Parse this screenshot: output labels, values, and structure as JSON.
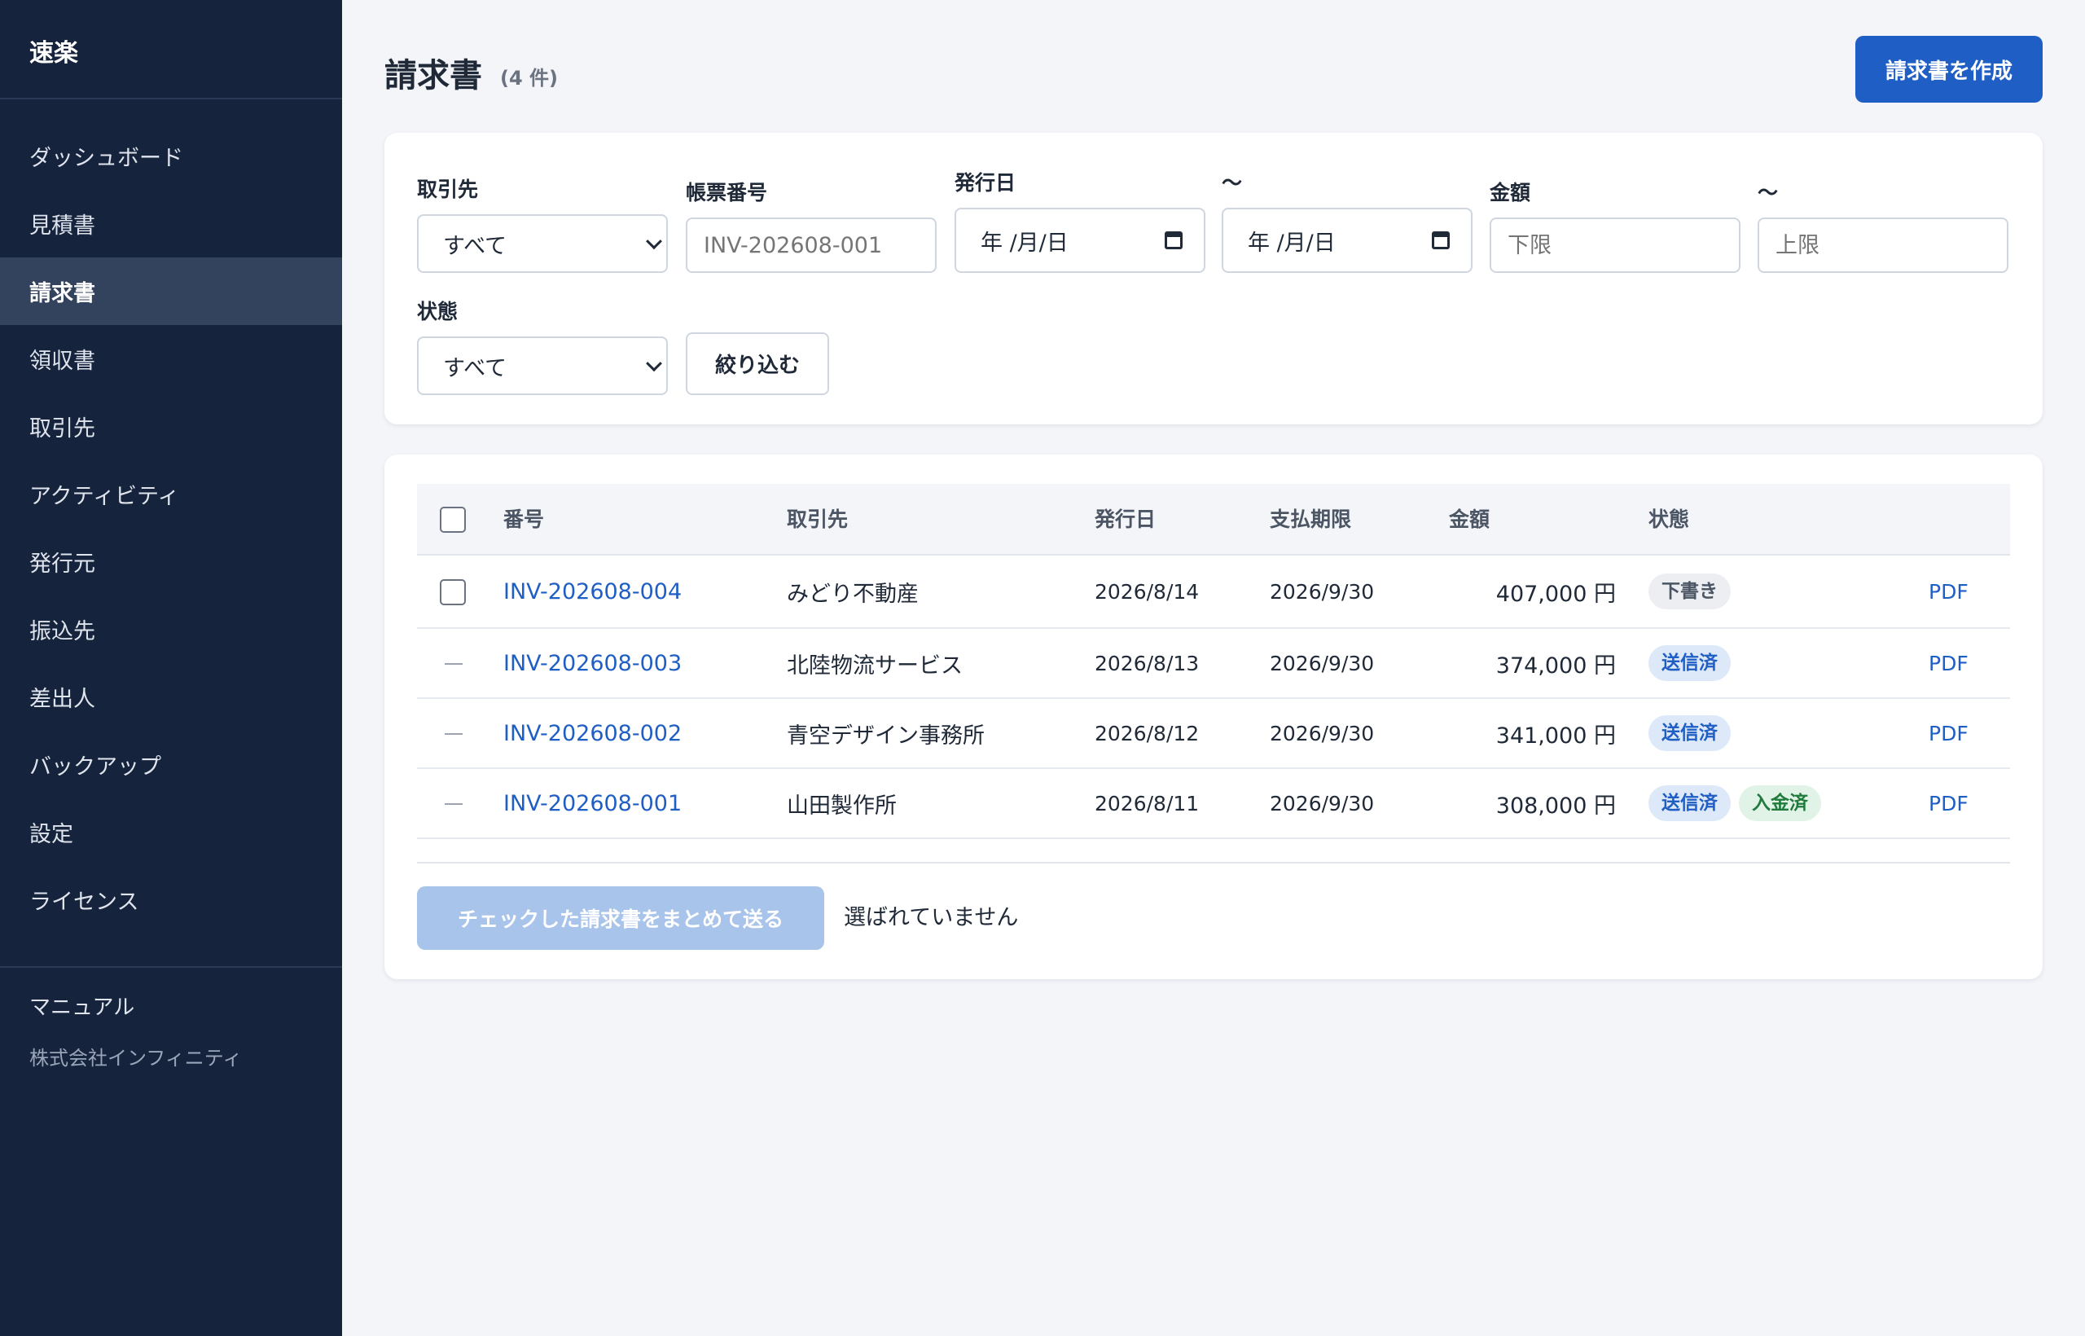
{
  "app": {
    "brand": "速楽"
  },
  "sidebar": {
    "items": [
      {
        "label": "ダッシュボード"
      },
      {
        "label": "見積書"
      },
      {
        "label": "請求書"
      },
      {
        "label": "領収書"
      },
      {
        "label": "取引先"
      },
      {
        "label": "アクティビティ"
      },
      {
        "label": "発行元"
      },
      {
        "label": "振込先"
      },
      {
        "label": "差出人"
      },
      {
        "label": "バックアップ"
      },
      {
        "label": "設定"
      },
      {
        "label": "ライセンス"
      }
    ],
    "active_item": "請求書",
    "manual_label": "マニュアル",
    "company": "株式会社インフィニティ"
  },
  "header": {
    "title": "請求書",
    "count": "(4 件)",
    "create_button": "請求書を作成"
  },
  "filters": {
    "client": {
      "label": "取引先",
      "value": "すべて"
    },
    "doc_number": {
      "label": "帳票番号",
      "placeholder": "INV-202608-001"
    },
    "issue_date": {
      "label": "発行日",
      "from_value": "年 /月/日",
      "to_label": "〜",
      "to_value": "年 /月/日"
    },
    "amount": {
      "label": "金額",
      "min_placeholder": "下限",
      "to_label": "〜",
      "max_placeholder": "上限"
    },
    "status": {
      "label": "状態",
      "value": "すべて"
    },
    "apply_button": "絞り込む"
  },
  "table": {
    "columns": [
      "番号",
      "取引先",
      "発行日",
      "支払期限",
      "金額",
      "状態"
    ],
    "rows": [
      {
        "number": "INV-202608-004",
        "client": "みどり不動産",
        "issued": "2026/8/14",
        "due": "2026/9/30",
        "amount": "407,000 円",
        "badges": [
          "下書き"
        ],
        "pdf": "PDF",
        "selectable": true
      },
      {
        "number": "INV-202608-003",
        "client": "北陸物流サービス",
        "issued": "2026/8/13",
        "due": "2026/9/30",
        "amount": "374,000 円",
        "badges": [
          "送信済"
        ],
        "pdf": "PDF",
        "selectable": false
      },
      {
        "number": "INV-202608-002",
        "client": "青空デザイン事務所",
        "issued": "2026/8/12",
        "due": "2026/9/30",
        "amount": "341,000 円",
        "badges": [
          "送信済"
        ],
        "pdf": "PDF",
        "selectable": false
      },
      {
        "number": "INV-202608-001",
        "client": "山田製作所",
        "issued": "2026/8/11",
        "due": "2026/9/30",
        "amount": "308,000 円",
        "badges": [
          "送信済",
          "入金済"
        ],
        "pdf": "PDF",
        "selectable": false
      }
    ]
  },
  "bulk": {
    "send_button": "チェックした請求書をまとめて送る",
    "selection_status": "選ばれていません"
  },
  "colors": {
    "sidebar_bg": "#15233d",
    "sidebar_active": "#34435d",
    "accent": "#1f5ec4",
    "page_bg": "#f3f5f9",
    "badge_draft": "#eceef2",
    "badge_sent": "#dde8f8",
    "badge_paid": "#e1f3e6"
  }
}
